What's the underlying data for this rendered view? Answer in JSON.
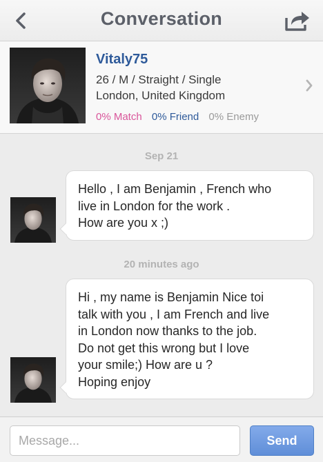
{
  "navbar": {
    "title": "Conversation",
    "back_icon": "chevron-left-icon",
    "share_icon": "share-icon"
  },
  "profile": {
    "username": "Vitaly75",
    "details_line1": "26 / M / Straight / Single",
    "details_line2": "London, United Kingdom",
    "stats": {
      "match": "0% Match",
      "friend": "0% Friend",
      "enemy": "0% Enemy"
    },
    "chevron_icon": "chevron-right-icon"
  },
  "messages": [
    {
      "timestamp": "Sep 21",
      "lines": [
        "Hello , I am Benjamin , French who",
        "live in London for the work .",
        "How are you x ;)"
      ]
    },
    {
      "timestamp": "20 minutes ago",
      "lines": [
        "Hi , my name is Benjamin Nice toi",
        "talk with you , I am French and live",
        "in London now thanks to the job.",
        "Do not get this wrong but I love",
        "your smile;) How are u ?",
        "Hoping enjoy"
      ]
    }
  ],
  "composer": {
    "placeholder": "Message...",
    "send_label": "Send"
  },
  "colors": {
    "username": "#2e5a9a",
    "match": "#d9559a",
    "friend": "#2e5a9a",
    "enemy": "#9a9a9a",
    "send_button": "#6b97de"
  }
}
